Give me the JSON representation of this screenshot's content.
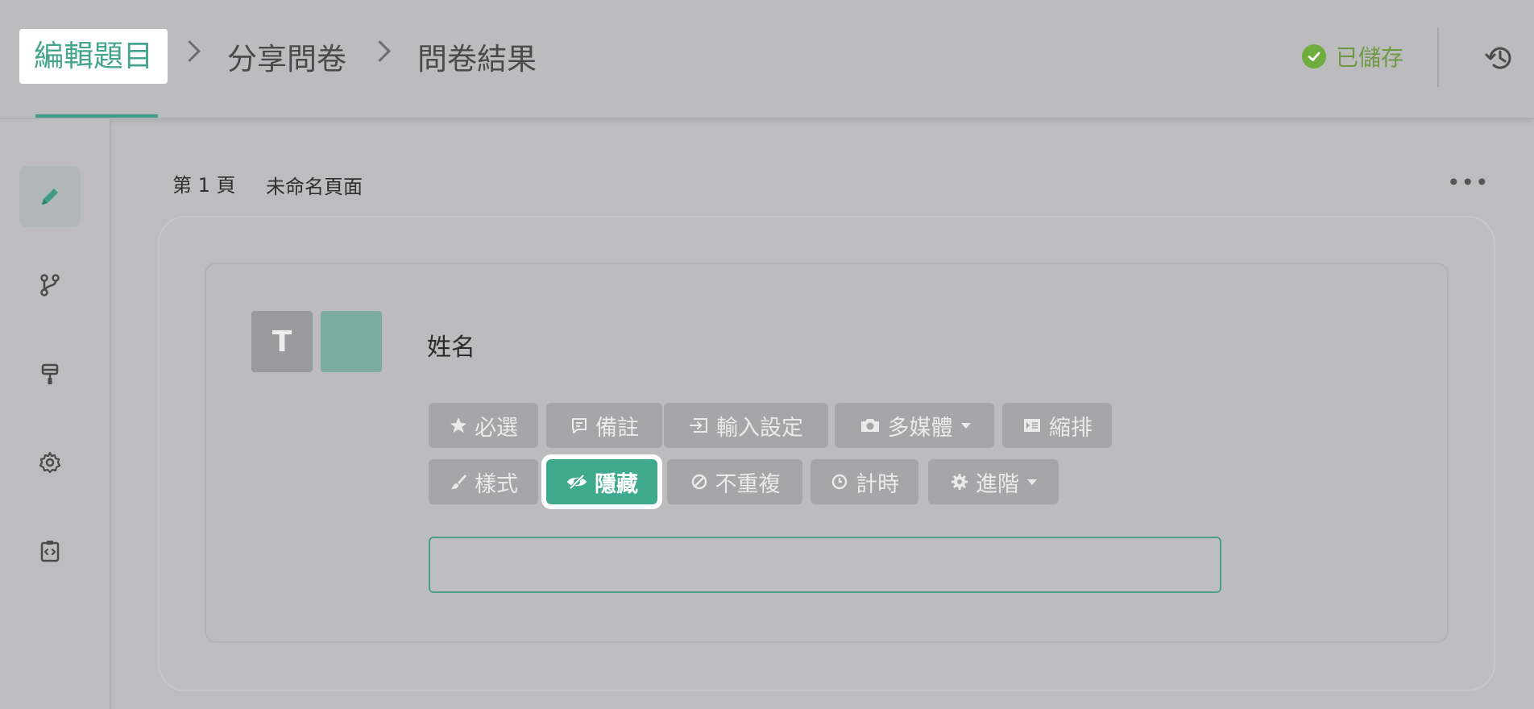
{
  "header": {
    "steps": [
      {
        "label": "編輯題目",
        "active": true
      },
      {
        "label": "分享問卷",
        "active": false
      },
      {
        "label": "問卷結果",
        "active": false
      }
    ],
    "saved_label": "已儲存"
  },
  "rail": {
    "items": [
      {
        "icon": "pencil-icon",
        "active": true
      },
      {
        "icon": "branch-icon",
        "active": false
      },
      {
        "icon": "paint-roller-icon",
        "active": false
      },
      {
        "icon": "gear-icon",
        "active": false
      },
      {
        "icon": "code-icon",
        "active": false
      }
    ]
  },
  "page": {
    "number_label": "第 1 頁",
    "name": "未命名頁面"
  },
  "question": {
    "type_letter": "T",
    "title": "姓名",
    "answer_value": "",
    "options_row1": [
      {
        "label": "必選",
        "icon": "star-icon"
      },
      {
        "label": "備註",
        "icon": "comment-icon"
      },
      {
        "label": "輸入設定",
        "icon": "input-icon"
      },
      {
        "label": "多媒體",
        "icon": "camera-icon",
        "dropdown": true
      },
      {
        "label": "縮排",
        "icon": "indent-icon"
      }
    ],
    "options_row2": [
      {
        "label": "樣式",
        "icon": "brush-icon"
      },
      {
        "label": "隱藏",
        "icon": "eye-slash-icon",
        "active": true
      },
      {
        "label": "不重複",
        "icon": "ban-icon"
      },
      {
        "label": "計時",
        "icon": "clock-icon"
      },
      {
        "label": "進階",
        "icon": "gear-icon",
        "dropdown": true
      }
    ]
  },
  "colors": {
    "accent": "#3ea98c",
    "saved": "#6fae3e",
    "background": "#bdbdbf"
  }
}
